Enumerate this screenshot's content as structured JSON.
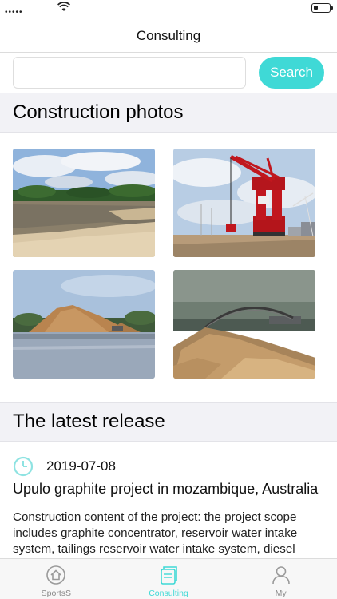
{
  "status_bar": {
    "dots": "•••••"
  },
  "nav": {
    "title": "Consulting"
  },
  "search": {
    "value": "",
    "placeholder": "",
    "button_label": "Search"
  },
  "photos": {
    "title": "Construction photos",
    "items": [
      {
        "name": "river-sand-bank-photo"
      },
      {
        "name": "port-crane-photo"
      },
      {
        "name": "sand-pile-waterfront-photo"
      },
      {
        "name": "sand-dredging-photo"
      }
    ]
  },
  "latest": {
    "title": "The latest release",
    "item": {
      "date": "2019-07-08",
      "title": "Upulo graphite project in mozambique, Australia",
      "content": "Construction content of the project: the project scope includes graphite concentrator, reservoir water intake system, tailings reservoir water intake system, diesel"
    }
  },
  "tabs": [
    {
      "label": "SportsS",
      "icon": "home-icon",
      "active": false
    },
    {
      "label": "Consulting",
      "icon": "documents-icon",
      "active": true
    },
    {
      "label": "My",
      "icon": "person-icon",
      "active": false
    }
  ],
  "colors": {
    "accent": "#3fd9d6",
    "section_bg": "#f2f2f6",
    "tab_inactive": "#8a8a8a"
  }
}
